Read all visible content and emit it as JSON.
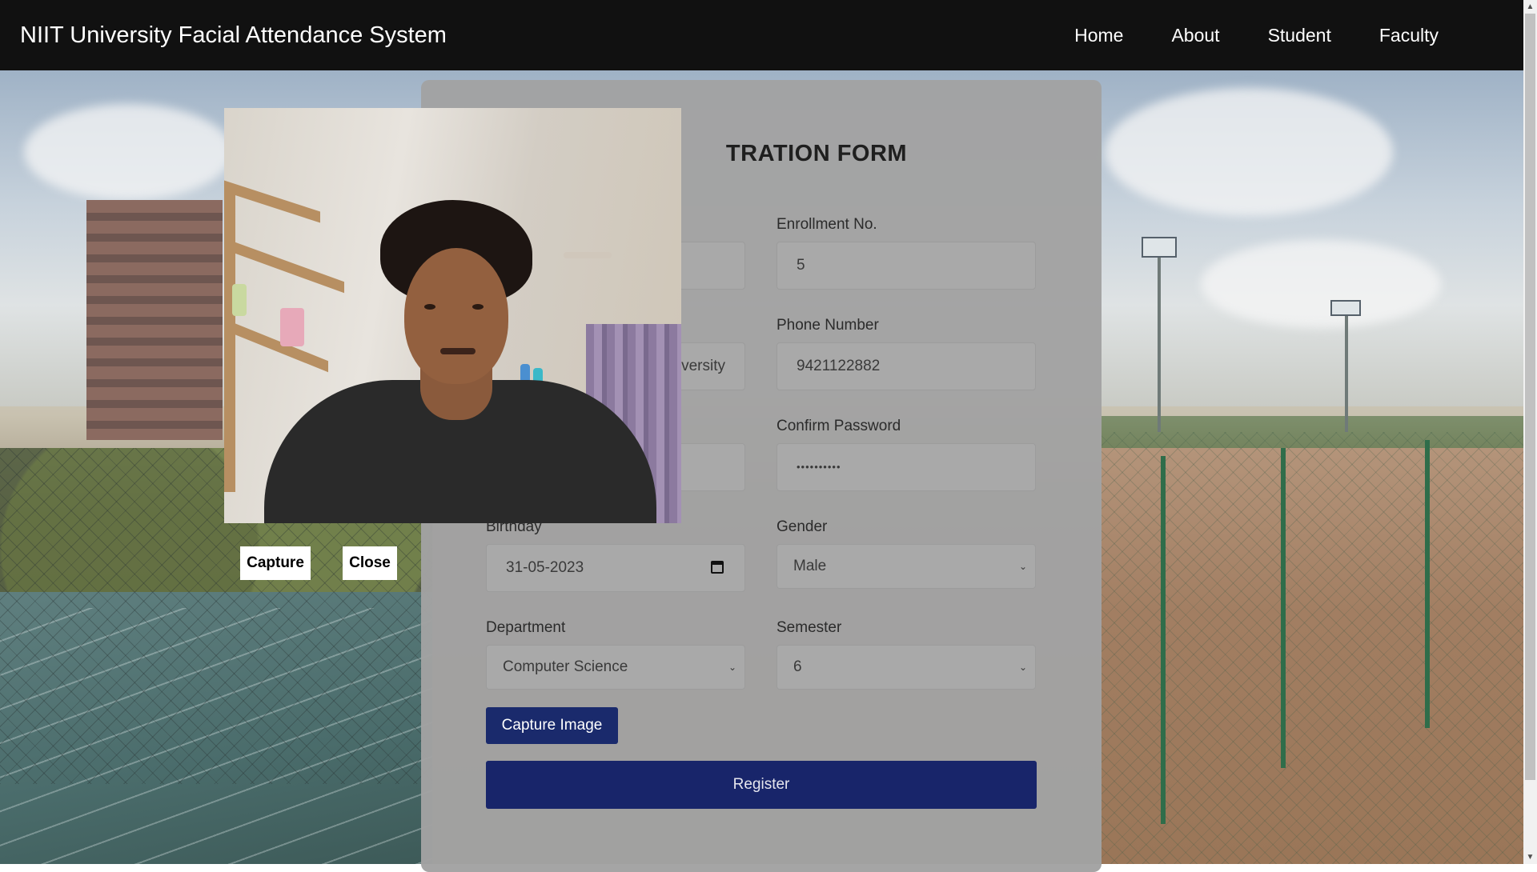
{
  "navbar": {
    "brand": "NIIT University Facial Attendance System",
    "links": [
      "Home",
      "About",
      "Student",
      "Faculty"
    ]
  },
  "form": {
    "title_visible": "TRATION FORM",
    "fields": {
      "name_value": "",
      "university_value_visible": "versity",
      "password_value": "",
      "enrollment_label": "Enrollment No.",
      "enrollment_value": "5",
      "phone_label": "Phone Number",
      "phone_value": "9421122882",
      "confirm_password_label": "Confirm Password",
      "confirm_password_value": "••••••••••",
      "birthday_label": "Birthday",
      "birthday_value": "31-05-2023",
      "gender_label": "Gender",
      "gender_value": "Male",
      "department_label": "Department",
      "department_value": "Computer Science",
      "semester_label": "Semester",
      "semester_value": "6"
    },
    "capture_image_button": "Capture Image",
    "register_button": "Register"
  },
  "webcam_popup": {
    "capture_button": "Capture",
    "close_button": "Close"
  },
  "colors": {
    "navbar": "#111111",
    "primary_button": "#18256a",
    "card": "#a2a2a2"
  }
}
